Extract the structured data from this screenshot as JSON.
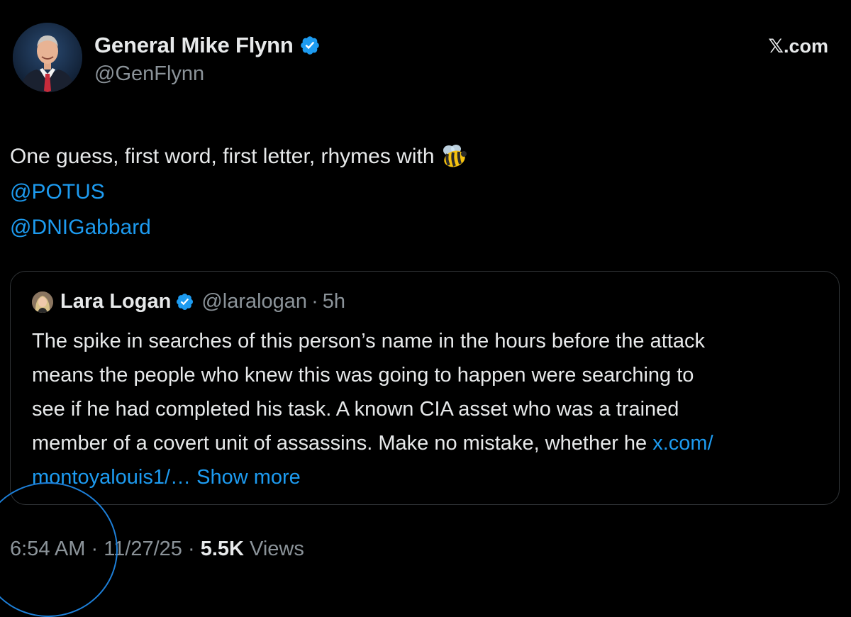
{
  "post": {
    "author": {
      "display_name": "General Mike Flynn",
      "handle": "@GenFlynn",
      "verified": true
    },
    "brand": "𝕏.com",
    "text_line": "One guess, first word, first letter, rhymes with",
    "emoji": "bee-emoji",
    "mentions": [
      "@POTUS",
      "@DNIGabbard"
    ],
    "quoted_post": {
      "display_name": "Lara Logan",
      "handle": "@laralogan",
      "separator": "·",
      "time": "5h",
      "verified": true,
      "lines": [
        "The spike in searches of this person’s name in the hours before the attack",
        "means the people who knew this was going to happen were searching to",
        "see if he had completed his task. A known CIA asset who was a trained"
      ],
      "line4_text": "member of a covert unit of assassins. Make no mistake, whether he ",
      "link_part1": "x.com/",
      "link_part2": "montoyalouis1/…",
      "show_more": "Show more"
    },
    "meta": {
      "time": "6:54 AM",
      "sep1": " · ",
      "date": "11/27/25",
      "sep2": " · ",
      "views_count": "5.5K",
      "views_label": " Views"
    }
  },
  "colors": {
    "background": "#000000",
    "text": "#e7e9ea",
    "secondary": "#8b9399",
    "link": "#1d9bf0",
    "border": "#2f3336",
    "annotation": "#1d7fd8"
  }
}
